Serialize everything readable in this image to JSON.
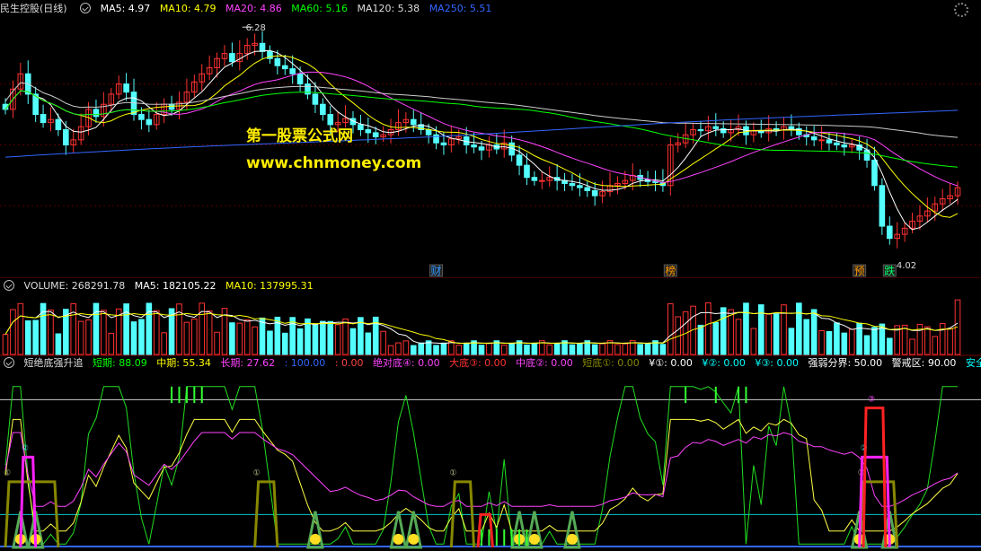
{
  "title_bar": {
    "stock": "民生控股(日线)",
    "ma": [
      {
        "label": "MA5: 4.97",
        "color": "#ffffff"
      },
      {
        "label": "MA10: 4.79",
        "color": "#ffff00"
      },
      {
        "label": "MA20: 4.86",
        "color": "#ff44ff"
      },
      {
        "label": "MA60: 5.16",
        "color": "#00ff00"
      },
      {
        "label": "MA120: 5.38",
        "color": "#dddddd"
      },
      {
        "label": "MA250: 5.51",
        "color": "#3366ff"
      }
    ]
  },
  "watermark": {
    "line1": "第一股票公式网",
    "line2": "www.chnmoney.com"
  },
  "price_labels": {
    "high": "6.28",
    "low": "4.02"
  },
  "event_tags": [
    {
      "text": "财",
      "color": "#3399ff"
    },
    {
      "text": "榜",
      "color": "#ff9900"
    },
    {
      "text": "预",
      "color": "#ff9900"
    },
    {
      "text": "跌",
      "color": "#00ff66"
    }
  ],
  "volume_bar": {
    "label": "VOLUME: 268291.78",
    "ma5": "MA5: 182105.22",
    "ma10": "MA10: 137995.31"
  },
  "osc_bar": {
    "name": "短绝底强升追",
    "items": [
      {
        "label": "短期: 88.09",
        "color": "#00ff00"
      },
      {
        "label": "中期: 55.34",
        "color": "#ffff00"
      },
      {
        "label": "长期: 27.62",
        "color": "#ff44ff"
      },
      {
        "label": ": 100.00",
        "color": "#3366ff"
      },
      {
        "label": ": 0.00",
        "color": "#ff4444"
      },
      {
        "label": "绝对底④: 0.00",
        "color": "#ff44ff"
      },
      {
        "label": "大底③: 0.00",
        "color": "#ff3333"
      },
      {
        "label": "中底②: 0.00",
        "color": "#ff44ff"
      },
      {
        "label": "短底①: 0.00",
        "color": "#888800"
      },
      {
        "label": "¥①: 0.00",
        "color": "#ffffff"
      },
      {
        "label": "¥②: 0.00",
        "color": "#00ffff"
      },
      {
        "label": "¥③: 0.00",
        "color": "#00ffff"
      },
      {
        "label": "强弱分界: 50.00",
        "color": "#ffffff"
      },
      {
        "label": "警戒区: 90.00",
        "color": "#ffffff"
      },
      {
        "label": "安全",
        "color": "#00ffff"
      }
    ]
  },
  "chart_data": {
    "type": "candlestick",
    "series": [
      {
        "name": "MA5",
        "value": 4.97
      },
      {
        "name": "MA10",
        "value": 4.79
      },
      {
        "name": "MA20",
        "value": 4.86
      },
      {
        "name": "MA60",
        "value": 5.16
      },
      {
        "name": "MA120",
        "value": 5.38
      },
      {
        "name": "MA250",
        "value": 5.51
      }
    ],
    "price_range": [
      4.02,
      6.28
    ],
    "volume": {
      "value": 268291.78,
      "ma5": 182105.22,
      "ma10": 137995.31
    },
    "oscillator": {
      "short": 88.09,
      "mid": 55.34,
      "long": 27.62,
      "divide": 50.0,
      "alert": 90.0
    },
    "close": [
      5.55,
      5.75,
      5.9,
      5.7,
      5.5,
      5.42,
      5.45,
      5.35,
      5.2,
      5.25,
      5.38,
      5.55,
      5.48,
      5.6,
      5.7,
      5.8,
      5.72,
      5.5,
      5.45,
      5.4,
      5.5,
      5.6,
      5.55,
      5.62,
      5.72,
      5.82,
      5.9,
      5.96,
      6.05,
      6.1,
      6.02,
      6.1,
      6.18,
      6.2,
      6.12,
      6.05,
      5.98,
      5.95,
      5.9,
      5.8,
      5.7,
      5.6,
      5.5,
      5.4,
      5.42,
      5.46,
      5.4,
      5.35,
      5.32,
      5.28,
      5.3,
      5.35,
      5.42,
      5.45,
      5.4,
      5.35,
      5.3,
      5.22,
      5.2,
      5.26,
      5.28,
      5.2,
      5.18,
      5.15,
      5.2,
      5.16,
      5.22,
      5.1,
      5.0,
      4.88,
      4.85,
      4.85,
      4.88,
      4.85,
      4.82,
      4.8,
      4.78,
      4.75,
      4.7,
      4.74,
      4.8,
      4.82,
      4.85,
      4.9,
      4.86,
      4.84,
      4.83,
      4.8,
      5.2,
      5.22,
      5.3,
      5.35,
      5.34,
      5.38,
      5.36,
      5.32,
      5.35,
      5.38,
      5.3,
      5.34,
      5.32,
      5.36,
      5.35,
      5.38,
      5.36,
      5.3,
      5.28,
      5.25,
      5.25,
      5.22,
      5.2,
      5.18,
      5.2,
      5.15,
      5.05,
      4.8,
      4.4,
      4.28,
      4.32,
      4.38,
      4.45,
      4.5,
      4.55,
      4.62,
      4.67,
      4.7,
      4.78
    ]
  }
}
